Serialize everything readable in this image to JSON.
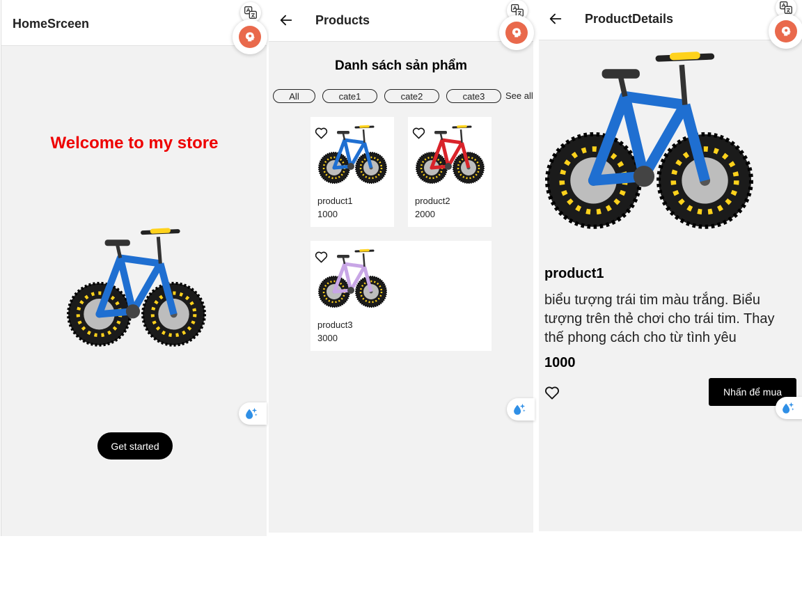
{
  "home": {
    "title": "HomeSrceen",
    "welcome": "Welcome to my store",
    "get_started": "Get started"
  },
  "products": {
    "title": "Products",
    "heading": "Danh sách sản phẩm",
    "chips": [
      "All",
      "cate1",
      "cate2",
      "cate3"
    ],
    "see_all": "See all",
    "items": [
      {
        "name": "product1",
        "price": "1000",
        "bike_color": "#1f6fd1"
      },
      {
        "name": "product2",
        "price": "2000",
        "bike_color": "#d9232a"
      },
      {
        "name": "product3",
        "price": "3000",
        "bike_color": "#c8a6e6"
      }
    ]
  },
  "details": {
    "title": "ProductDetails",
    "name": "product1",
    "description": "biểu tượng trái tim màu trắng. Biểu tượng trên thẻ chơi cho trái tim. Thay thế phong cách cho từ tình yêu",
    "price": "1000",
    "buy": "Nhấn để mua"
  },
  "colors": {
    "accent_red": "#ee0000",
    "bike_blue": "#1f6fd1",
    "brain_orange": "#e9694c",
    "drop_blue": "#2f8fe6"
  }
}
